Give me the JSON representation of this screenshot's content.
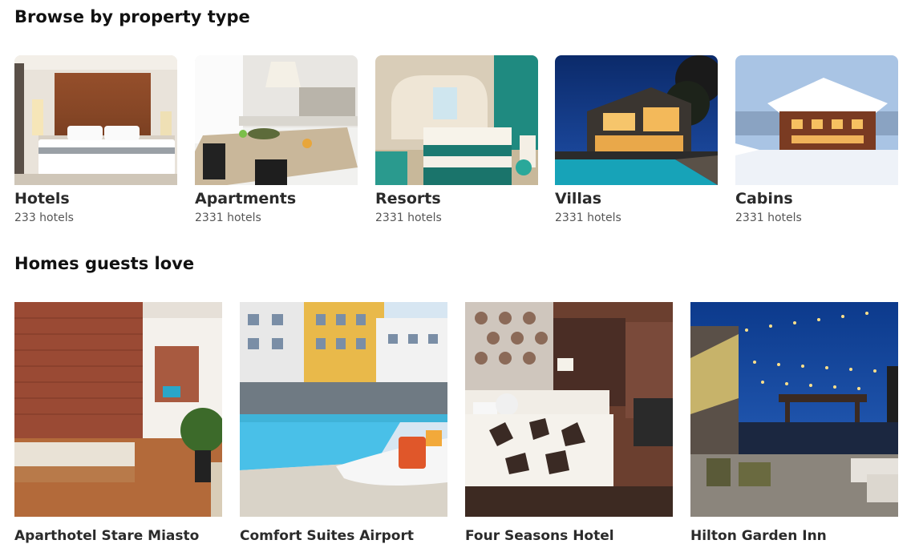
{
  "sections": {
    "browse_title": "Browse by property type",
    "homes_title": "Homes guests love"
  },
  "property_types": [
    {
      "name": "Hotels",
      "count": "233 hotels",
      "icon": "hotel-bedroom-photo"
    },
    {
      "name": "Apartments",
      "count": "2331 hotels",
      "icon": "apartment-kitchen-photo"
    },
    {
      "name": "Resorts",
      "count": "2331 hotels",
      "icon": "resort-room-photo"
    },
    {
      "name": "Villas",
      "count": "2331 hotels",
      "icon": "villa-pool-photo"
    },
    {
      "name": "Cabins",
      "count": "2331 hotels",
      "icon": "snowy-cabin-photo"
    }
  ],
  "homes": [
    {
      "name": "Aparthotel Stare Miasto",
      "icon": "brick-loft-bedroom-photo"
    },
    {
      "name": "Comfort Suites Airport",
      "icon": "hotel-pool-photo"
    },
    {
      "name": "Four Seasons Hotel",
      "icon": "patterned-bedroom-photo"
    },
    {
      "name": "Hilton Garden Inn",
      "icon": "rooftop-terrace-photo"
    }
  ]
}
